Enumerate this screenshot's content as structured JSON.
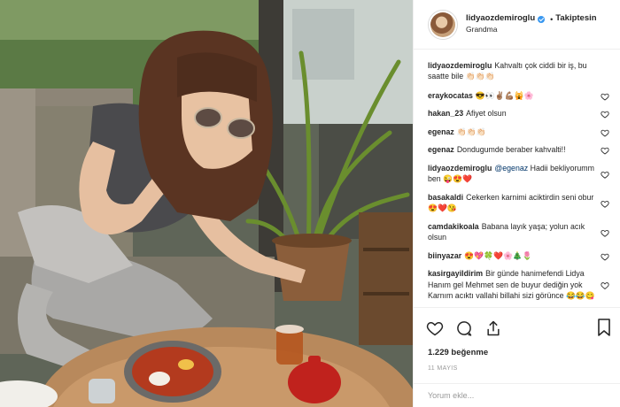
{
  "post": {
    "username": "lidyaozdemiroglu",
    "follow_status": "Takiptesin",
    "separator": "•",
    "location": "Grandma"
  },
  "comments": [
    {
      "user": "lidyaozdemiroglu",
      "text": "Kahvaltı çok ciddi bir iş, bu saatte bile 👏🏻👏🏻👏🏻",
      "is_caption": true
    },
    {
      "user": "eraykocatas",
      "text": "😎👀✌🏽💪🏽🙀🌸"
    },
    {
      "user": "hakan_23",
      "text": "Afiyet olsun"
    },
    {
      "user": "egenaz",
      "text": "👏🏻👏🏻👏🏻"
    },
    {
      "user": "egenaz",
      "text": "Dondugumde beraber kahvalti!!"
    },
    {
      "user": "lidyaozdemiroglu",
      "mention": "@egenaz",
      "text": "Hadii bekliyorumm ben 😜😍❤️"
    },
    {
      "user": "basakaldi",
      "text": "Cekerken karnimi aciktirdin seni obur😍❤️😘"
    },
    {
      "user": "camdakikoala",
      "text": "Babana layık yaşa; yolun acık olsun"
    },
    {
      "user": "biinyazar",
      "text": "😍💖🍀❤️🌸🎄🌷"
    },
    {
      "user": "kasirgayildirim",
      "text": "Bir günde hanimefendi Lidya Hanım gel Mehmet sen de buyur dediğin yok Karnım acıktı vallahi billahi sizi görünce 😂😂😋"
    }
  ],
  "likes": "1.229 beğenme",
  "date": "11 MAYIS",
  "add_comment": {
    "placeholder": "Yorum ekle..."
  },
  "icons": {
    "heart": "heart-icon",
    "comment": "comment-icon",
    "share": "share-icon",
    "save": "bookmark-icon",
    "verified": "verified-badge-icon"
  },
  "colors": {
    "text": "#262626",
    "muted": "#999999",
    "mention": "#003569",
    "verified": "#3897f0",
    "border": "#efefef"
  }
}
